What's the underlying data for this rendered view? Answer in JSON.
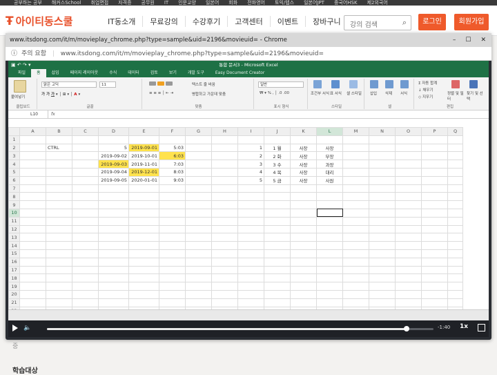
{
  "site": {
    "top_strip": [
      "공부하는 공부",
      "해커스School",
      "취업면접",
      "자격증",
      "공무원",
      "IT",
      "인문교양",
      "일본어",
      "회화",
      "전화영어",
      "토익/텝스",
      "일본어JPT",
      "중국어HSK",
      "제2외국어"
    ],
    "logo_text": "아이티동스쿨",
    "nav": [
      "IT동소개",
      "무료강의",
      "수강후기",
      "고객센터",
      "이벤트",
      "장바구니"
    ],
    "search_placeholder": "강의 검색",
    "login_label": "로그인",
    "join_label": "회원가입"
  },
  "window": {
    "title": "www.itsdong.com/it/m/movieplay_chrome.php?type=sample&uid=2196&movieuid= - Chrome",
    "controls": [
      "–",
      "☐",
      "✕"
    ],
    "security_text": "주의 요함",
    "url": "www.itsdong.com/it/m/movieplay_chrome.php?type=sample&uid=2196&movieuid="
  },
  "excel": {
    "title": "통합 문서3 - Microsoft Excel",
    "tabs": [
      "파일",
      "홈",
      "삽입",
      "페이지 레이아웃",
      "수식",
      "데이터",
      "검토",
      "보기",
      "개발 도구",
      "Easy Document Creator"
    ],
    "active_tab": "홈",
    "ribbon": {
      "clipboard_label": "클립보드",
      "paste_label": "붙여넣기",
      "font_name": "맑은 고딕",
      "font_size": "11",
      "font_label": "글꼴",
      "align_label": "맞춤",
      "wrap_text": "텍스트 줄 바꿈",
      "merge_center": "병합하고 가운데 맞춤",
      "number_format": "일반",
      "number_label": "표시 형식",
      "cond_format": "조건부 서식",
      "table_format": "표 서식",
      "cell_style": "셀 스타일",
      "styles_label": "스타일",
      "insert": "삽입",
      "delete": "삭제",
      "format": "서식",
      "cells_label": "셀",
      "autosum": "자동 합계",
      "fill": "채우기",
      "clear": "지우기",
      "sort_filter": "정렬 및 필터",
      "find_select": "찾기 및 선택",
      "editing_label": "편집"
    },
    "name_box": "L10",
    "fx": "fx",
    "columns": [
      "A",
      "B",
      "C",
      "D",
      "E",
      "F",
      "G",
      "H",
      "I",
      "J",
      "K",
      "L",
      "M",
      "N",
      "O",
      "P",
      "Q"
    ],
    "selected_column": "L",
    "selected_row": 10,
    "rows": [
      {
        "n": 1,
        "cells": {}
      },
      {
        "n": 2,
        "cells": {
          "B": "CTRL",
          "D": "5",
          "E": "2019-09-01",
          "F": "5:03",
          "I": "1",
          "J": "1 월",
          "K": "사장",
          "L": "사장"
        }
      },
      {
        "n": 3,
        "cells": {
          "D": "2019-09-02",
          "E": "2019-10-01",
          "F": "6:03",
          "I": "2",
          "J": "2 화",
          "K": "사장",
          "L": "부장"
        }
      },
      {
        "n": 4,
        "cells": {
          "D": "2019-09-03",
          "E": "2019-11-01",
          "F": "7:03",
          "I": "3",
          "J": "3 수",
          "K": "사장",
          "L": "과장"
        }
      },
      {
        "n": 5,
        "cells": {
          "D": "2019-09-04",
          "E": "2019-12-01",
          "F": "8:03",
          "I": "4",
          "J": "4 목",
          "K": "사장",
          "L": "대리"
        }
      },
      {
        "n": 6,
        "cells": {
          "D": "2019-09-05",
          "E": "2020-01-01",
          "F": "9:03",
          "I": "5",
          "J": "5 금",
          "K": "사장",
          "L": "사원"
        }
      },
      {
        "n": 7,
        "cells": {}
      },
      {
        "n": 8,
        "cells": {}
      },
      {
        "n": 9,
        "cells": {}
      },
      {
        "n": 10,
        "cells": {}
      },
      {
        "n": 11,
        "cells": {}
      },
      {
        "n": 12,
        "cells": {}
      },
      {
        "n": 13,
        "cells": {}
      },
      {
        "n": 14,
        "cells": {}
      },
      {
        "n": 15,
        "cells": {}
      },
      {
        "n": 16,
        "cells": {}
      },
      {
        "n": 17,
        "cells": {}
      },
      {
        "n": 18,
        "cells": {}
      },
      {
        "n": 19,
        "cells": {}
      },
      {
        "n": 20,
        "cells": {}
      },
      {
        "n": 21,
        "cells": {}
      },
      {
        "n": 22,
        "cells": {}
      }
    ],
    "highlighted_cells": [
      "E2",
      "F3",
      "D4",
      "E5"
    ],
    "highlight_color": "#ffe24d"
  },
  "player": {
    "time_text": "-1:40",
    "speed_label": "1x",
    "progress": 0.93
  },
  "page_below": {
    "text1": "중",
    "text2": "학습대상"
  }
}
